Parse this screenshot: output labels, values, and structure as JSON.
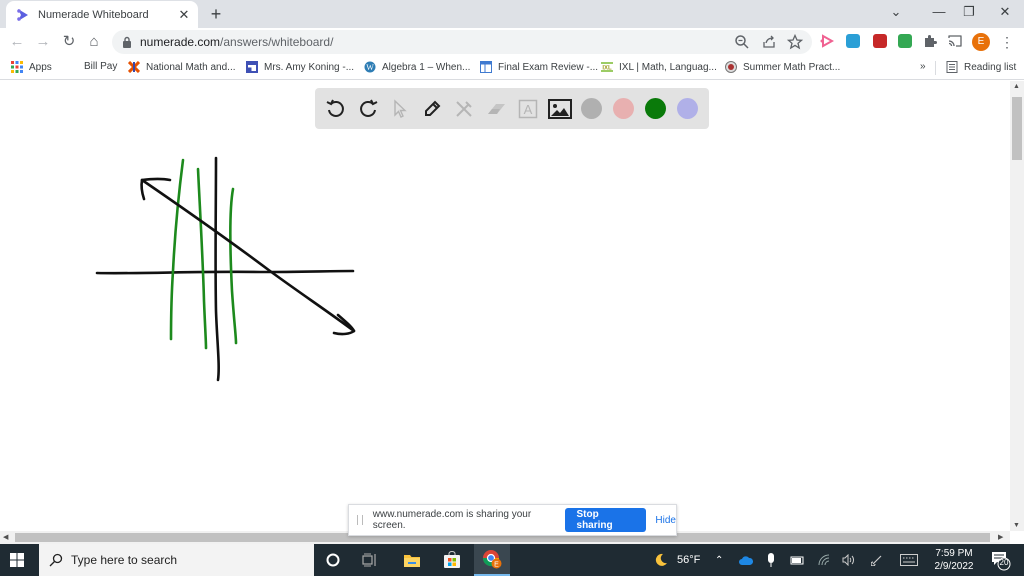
{
  "browser": {
    "tab": {
      "title": "Numerade Whiteboard",
      "close": "✕"
    },
    "new_tab": "+",
    "window_controls": {
      "tab_search": "⌄",
      "minimize": "—",
      "restore": "❐",
      "close": "✕"
    },
    "nav": {
      "back": "←",
      "forward": "→",
      "reload": "↻",
      "home": "⌂"
    },
    "url": {
      "host": "numerade.com",
      "path": "/answers/whiteboard/"
    },
    "profile_initial": "E",
    "menu": "⋮",
    "bookmarks": [
      {
        "label": "Apps",
        "icon": "apps-grid-icon"
      },
      {
        "label": "Bill Pay",
        "icon": "none"
      },
      {
        "label": "National Math and...",
        "icon": "nms-logo-icon"
      },
      {
        "label": "Mrs. Amy Koning -...",
        "icon": "google-sites-icon"
      },
      {
        "label": "Algebra 1 – When...",
        "icon": "wordpress-icon"
      },
      {
        "label": "Final Exam Review -...",
        "icon": "google-sites-icon"
      },
      {
        "label": "IXL | Math, Languag...",
        "icon": "ixl-icon"
      },
      {
        "label": "Summer Math Pract...",
        "icon": "site-icon"
      }
    ],
    "bookmarks_overflow": "»",
    "reading_list": "Reading list"
  },
  "whiteboard": {
    "tools": [
      {
        "name": "undo",
        "enabled": true
      },
      {
        "name": "redo",
        "enabled": true
      },
      {
        "name": "select",
        "enabled": false
      },
      {
        "name": "pen",
        "enabled": true
      },
      {
        "name": "tools",
        "enabled": false
      },
      {
        "name": "eraser",
        "enabled": false
      },
      {
        "name": "text",
        "enabled": false
      },
      {
        "name": "image",
        "enabled": true
      }
    ],
    "colors": [
      "#b0b0b0",
      "#e8b0b0",
      "#0a7a0a",
      "#b0b0e8"
    ],
    "stroke_colors": {
      "black": "#111111",
      "green": "#1d8a1d"
    }
  },
  "share_bar": {
    "message": "www.numerade.com is sharing your screen.",
    "stop_label": "Stop sharing",
    "hide_label": "Hide"
  },
  "taskbar": {
    "search_placeholder": "Type here to search",
    "weather": "56°F",
    "time": "7:59 PM",
    "date": "2/9/2022",
    "notifications": "20"
  }
}
